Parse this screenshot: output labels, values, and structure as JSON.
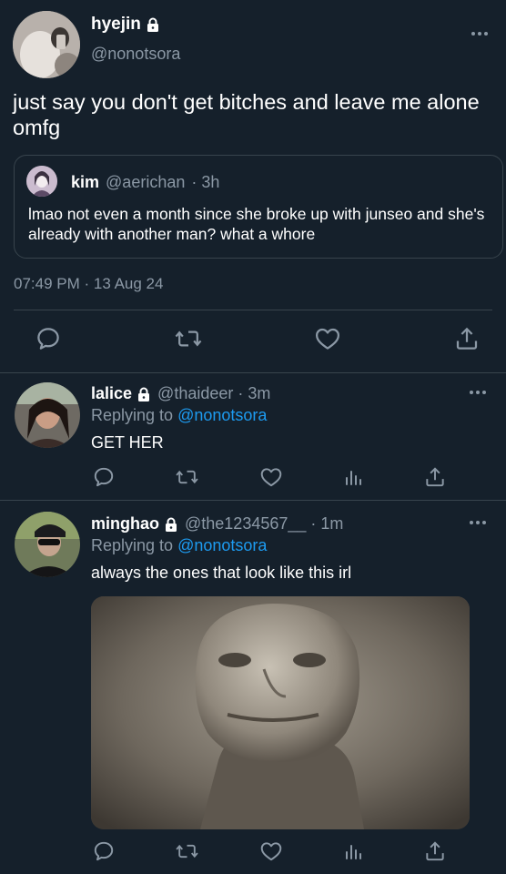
{
  "main_tweet": {
    "display_name": "hyejin",
    "handle": "@nonotsora",
    "text": "just say you don't get bitches and leave me alone omfg",
    "timestamp": "07:49 PM · 13 Aug 24",
    "quoted": {
      "display_name": "kim",
      "handle": "@aerichan",
      "time": "· 3h",
      "text": "lmao not even a month since she broke up with junseo and she's already with another man? what a whore"
    }
  },
  "replies": [
    {
      "display_name": "lalice",
      "handle": "@thaideer",
      "time": "· 3m",
      "replying_prefix": "Replying to",
      "replying_to": "@nonotsora",
      "text": "GET HER"
    },
    {
      "display_name": "minghao",
      "handle": "@the1234567__",
      "time": "· 1m",
      "replying_prefix": "Replying to",
      "replying_to": "@nonotsora",
      "text": "always the ones that look like this irl"
    }
  ],
  "colors": {
    "background": "#15202b",
    "secondary_text": "#8b98a5",
    "link": "#1d9bf0",
    "divider": "#38444d"
  }
}
